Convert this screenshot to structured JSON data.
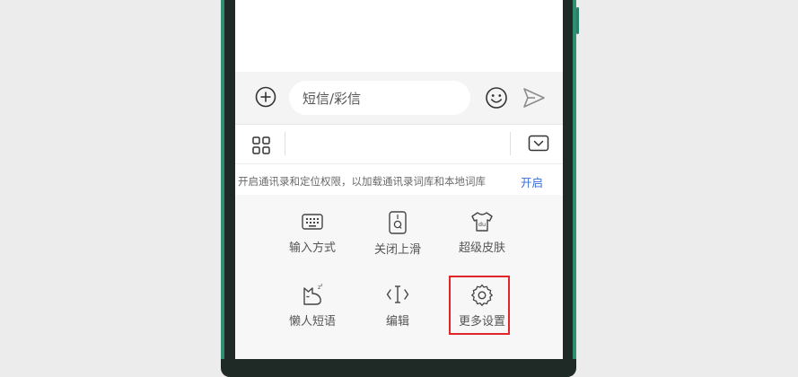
{
  "compose": {
    "placeholder": "短信/彩信"
  },
  "permission_bar": {
    "text": "开启通讯录和定位权限，以加载通讯录词库和本地词库",
    "action": "开启"
  },
  "keyboard_panel": {
    "items": [
      {
        "label": "输入方式",
        "icon": "keyboard-icon"
      },
      {
        "label": "关闭上滑",
        "icon": "swipe-up-icon"
      },
      {
        "label": "超级皮肤",
        "icon": "tshirt-icon"
      },
      {
        "label": "懒人短语",
        "icon": "sleepy-cat-icon"
      },
      {
        "label": "编辑",
        "icon": "cursor-edit-icon"
      },
      {
        "label": "更多设置",
        "icon": "gear-icon"
      }
    ]
  },
  "colors": {
    "accent": "#3a6ed8",
    "highlight": "#e0262a",
    "phone_trim": "#2f8f72"
  }
}
